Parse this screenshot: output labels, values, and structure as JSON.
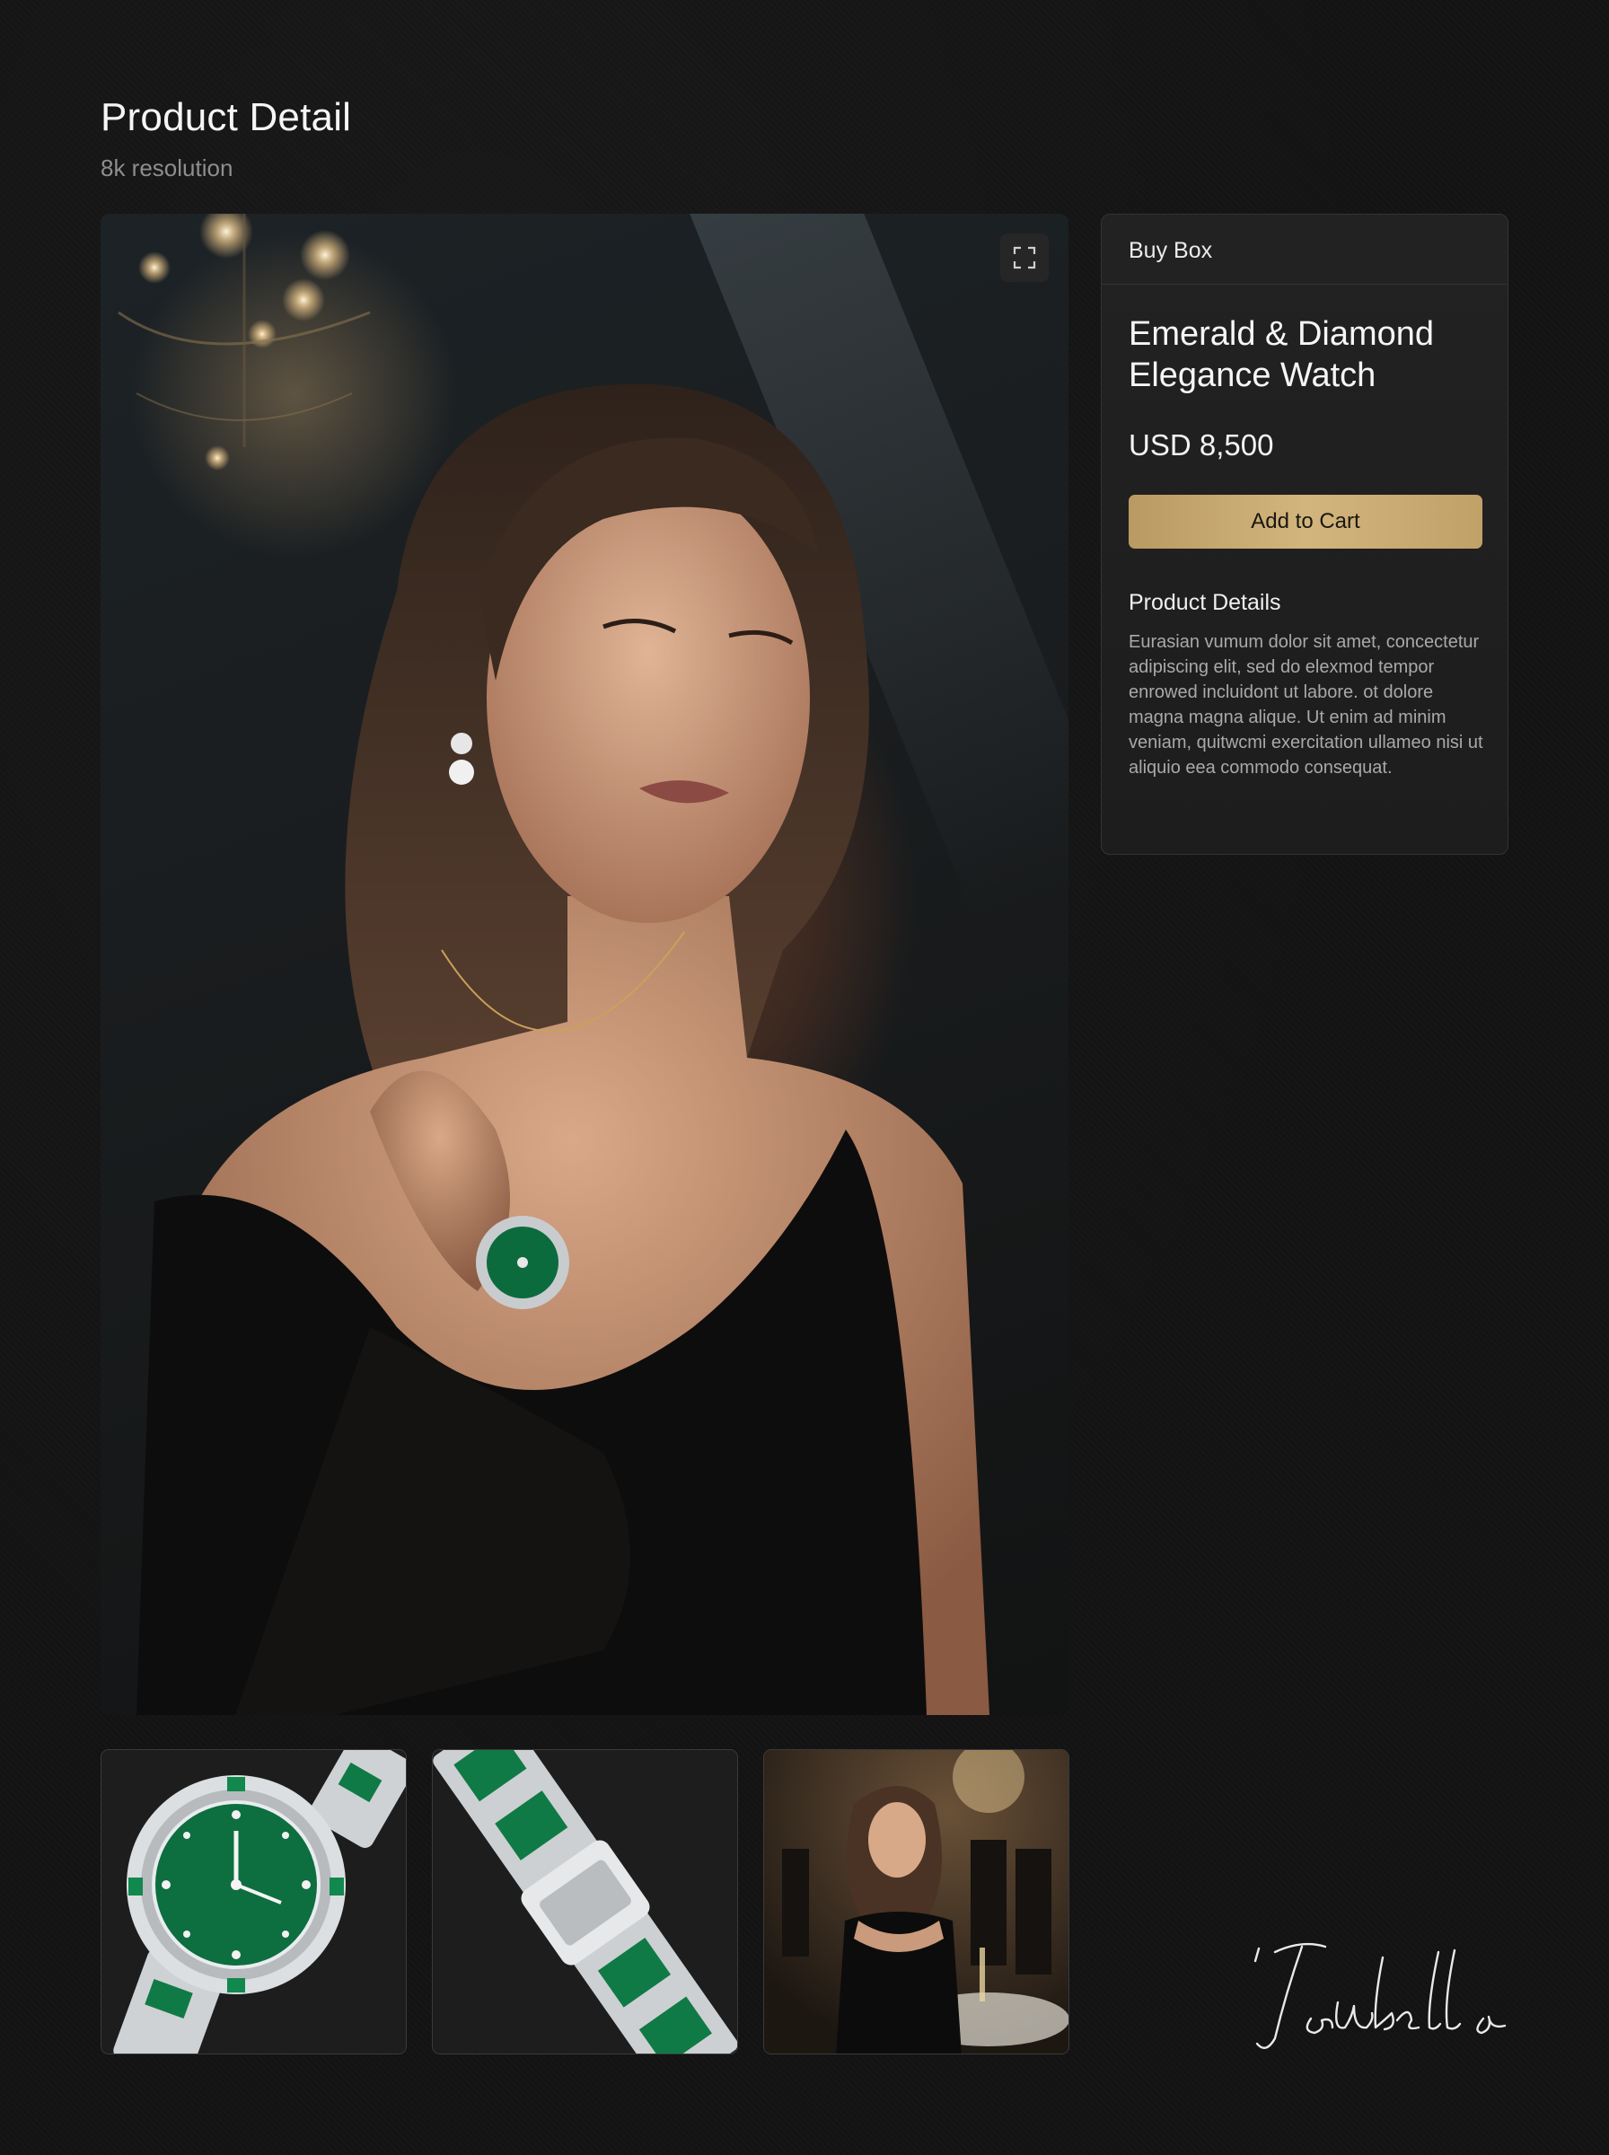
{
  "header": {
    "title": "Product Detail",
    "subtitle": "8k resolution"
  },
  "hero": {
    "expand_icon": "expand-icon"
  },
  "buy_box": {
    "label": "Buy Box",
    "product_name": "Emerald & Diamond Elegance Watch",
    "price": "USD 8,500",
    "add_to_cart_label": "Add to Cart",
    "details_heading": "Product Details",
    "details_text": "Eurasian vumum dolor sit amet, concectetur adipiscing elit, sed do elexmod tempor enrowed incluidont ut labore. ot dolore magna magna alique. Ut enim ad minim veniam, quitwcmi exercitation ullameo nisi ut aliquio eea commodo consequat."
  },
  "signature": {
    "text": "Isabella"
  },
  "colors": {
    "background": "#131313",
    "panel": "#1f1f1f",
    "accent_gold": "#c8aa70",
    "emerald": "#0f7a45"
  }
}
